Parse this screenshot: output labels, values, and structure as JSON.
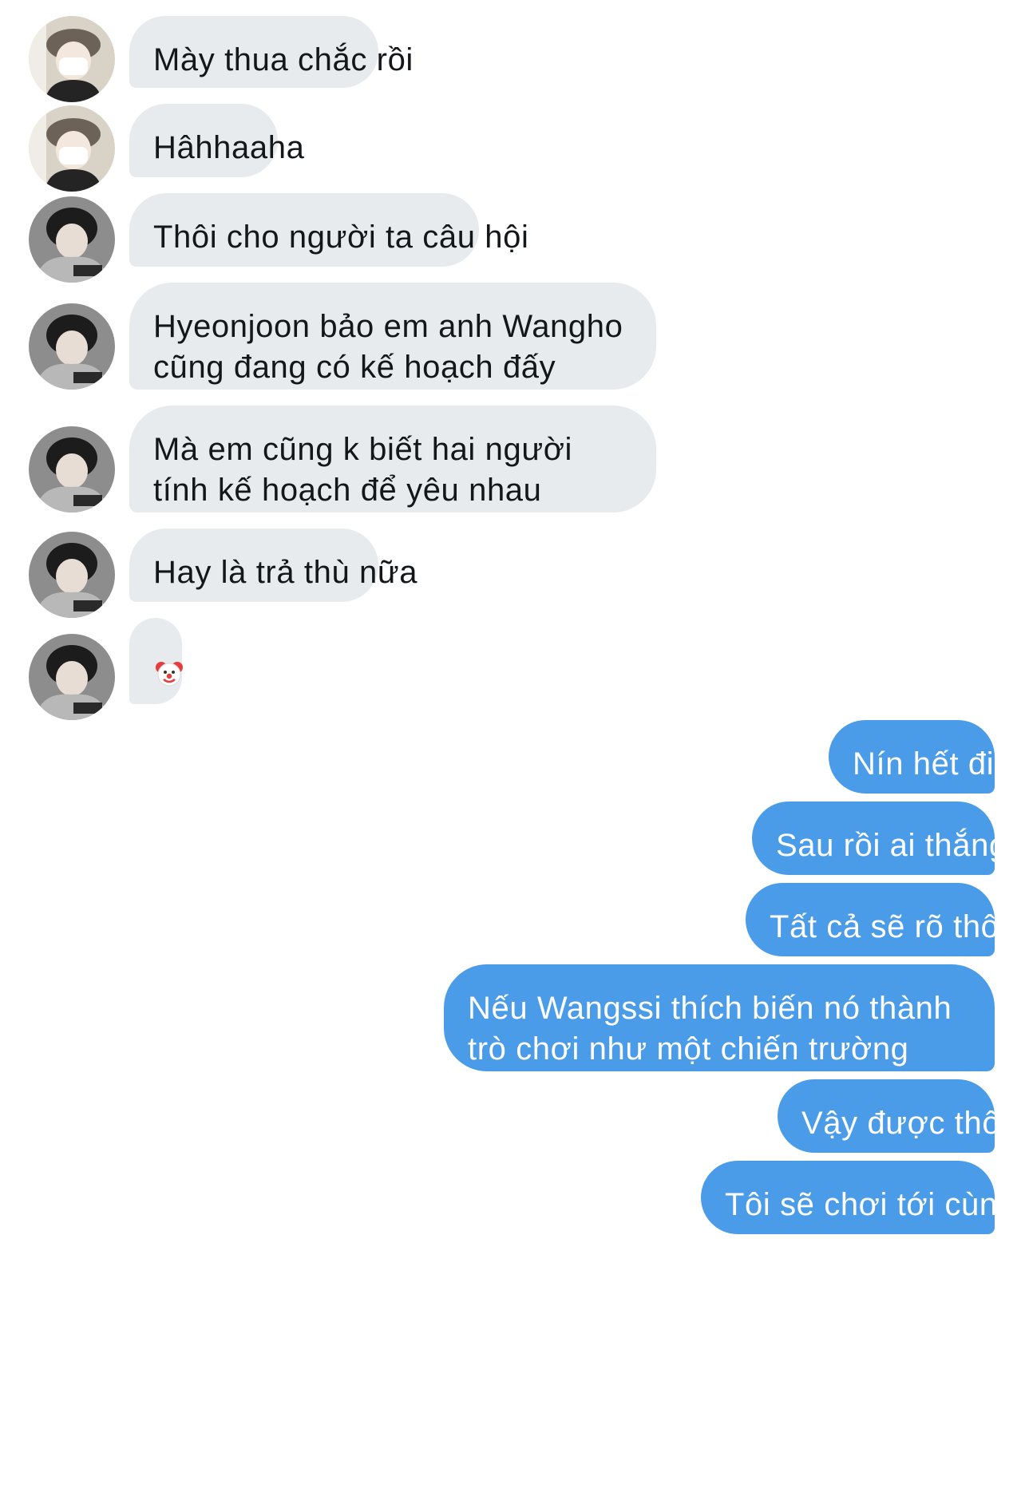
{
  "conversation": {
    "incoming": [
      {
        "text": "Mày thua chắc rồi",
        "avatar": "user-a-avatar"
      },
      {
        "text": "Hâhhaaha",
        "avatar": "user-a-avatar"
      },
      {
        "text": "Thôi cho người ta câu hội",
        "avatar": "user-b-avatar"
      },
      {
        "text": "Hyeonjoon bảo em anh Wangho cũng đang có kế hoạch đấy",
        "avatar": "user-b-avatar"
      },
      {
        "text": "Mà em cũng k biết hai người tính kế hoạch để yêu nhau",
        "avatar": "user-b-avatar"
      },
      {
        "text": "Hay là trả thù nữa",
        "avatar": "user-b-avatar"
      },
      {
        "text": "",
        "emoji": "clown-face-emoji",
        "avatar": "user-b-avatar"
      }
    ],
    "outgoing": [
      {
        "text": "Nín hết đi"
      },
      {
        "text": "Sau rồi ai thắng"
      },
      {
        "text": "Tất cả sẽ rõ thôi"
      },
      {
        "text": "Nếu Wangssi thích biến nó thành trò chơi như một chiến trường"
      },
      {
        "text": "Vậy được thôi"
      },
      {
        "text": "Tôi sẽ chơi tới cùng"
      }
    ]
  },
  "colors": {
    "incoming_bubble": "#e8ebee",
    "outgoing_bubble": "#4a9be8",
    "incoming_text": "#14171a",
    "outgoing_text": "#ffffff",
    "background": "#ffffff"
  }
}
